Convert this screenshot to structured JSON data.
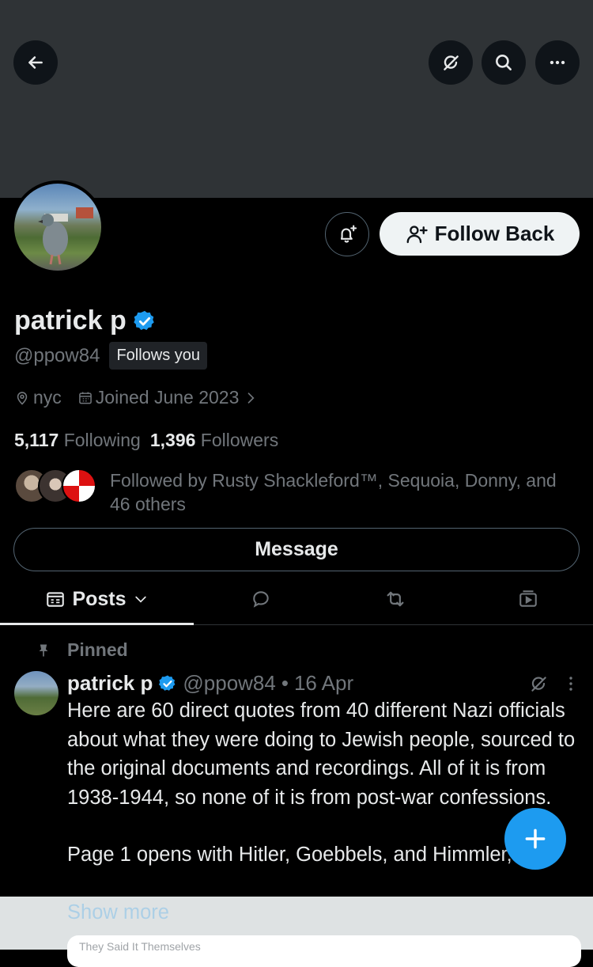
{
  "profile": {
    "name": "patrick p",
    "handle": "@ppow84",
    "follows_you": "Follows you",
    "location": "nyc",
    "joined": "Joined June 2023",
    "following_count": "5,117",
    "following_label": "Following",
    "followers_count": "1,396",
    "followers_label": "Followers",
    "followed_by": "Followed by Rusty Shackleford™, Sequoia, Donny, and 46 others"
  },
  "buttons": {
    "follow_back": "Follow Back",
    "message": "Message"
  },
  "tabs": {
    "posts": "Posts"
  },
  "post": {
    "pinned_label": "Pinned",
    "author_name": "patrick p",
    "author_handle": "@ppow84",
    "dot": "•",
    "date": "16 Apr",
    "paragraph1": "Here are 60 direct quotes from 40 different Nazi officials about what they were doing to Jewish people, sourced to the original documents and recordings. All of it is from 1938-1944, so none of it is from post-war confessions.",
    "paragraph2": "Page 1 opens with Hitler, Goebbels, and Himmler,",
    "show_more": "Show more",
    "card_title": "They Said It Themselves"
  },
  "colors": {
    "accent": "#1d9bf0",
    "background": "#000000",
    "banner": "#2f3336",
    "muted": "#71767b"
  },
  "icons": [
    "back-arrow-icon",
    "grok-icon",
    "search-icon",
    "more-icon",
    "bell-plus-icon",
    "add-user-icon",
    "verified-icon",
    "location-icon",
    "calendar-icon",
    "chevron-right-icon",
    "posts-icon",
    "chevron-down-icon",
    "replies-icon",
    "retweet-icon",
    "media-icon",
    "pin-icon",
    "post-grok-icon",
    "post-more-icon",
    "plus-icon"
  ]
}
